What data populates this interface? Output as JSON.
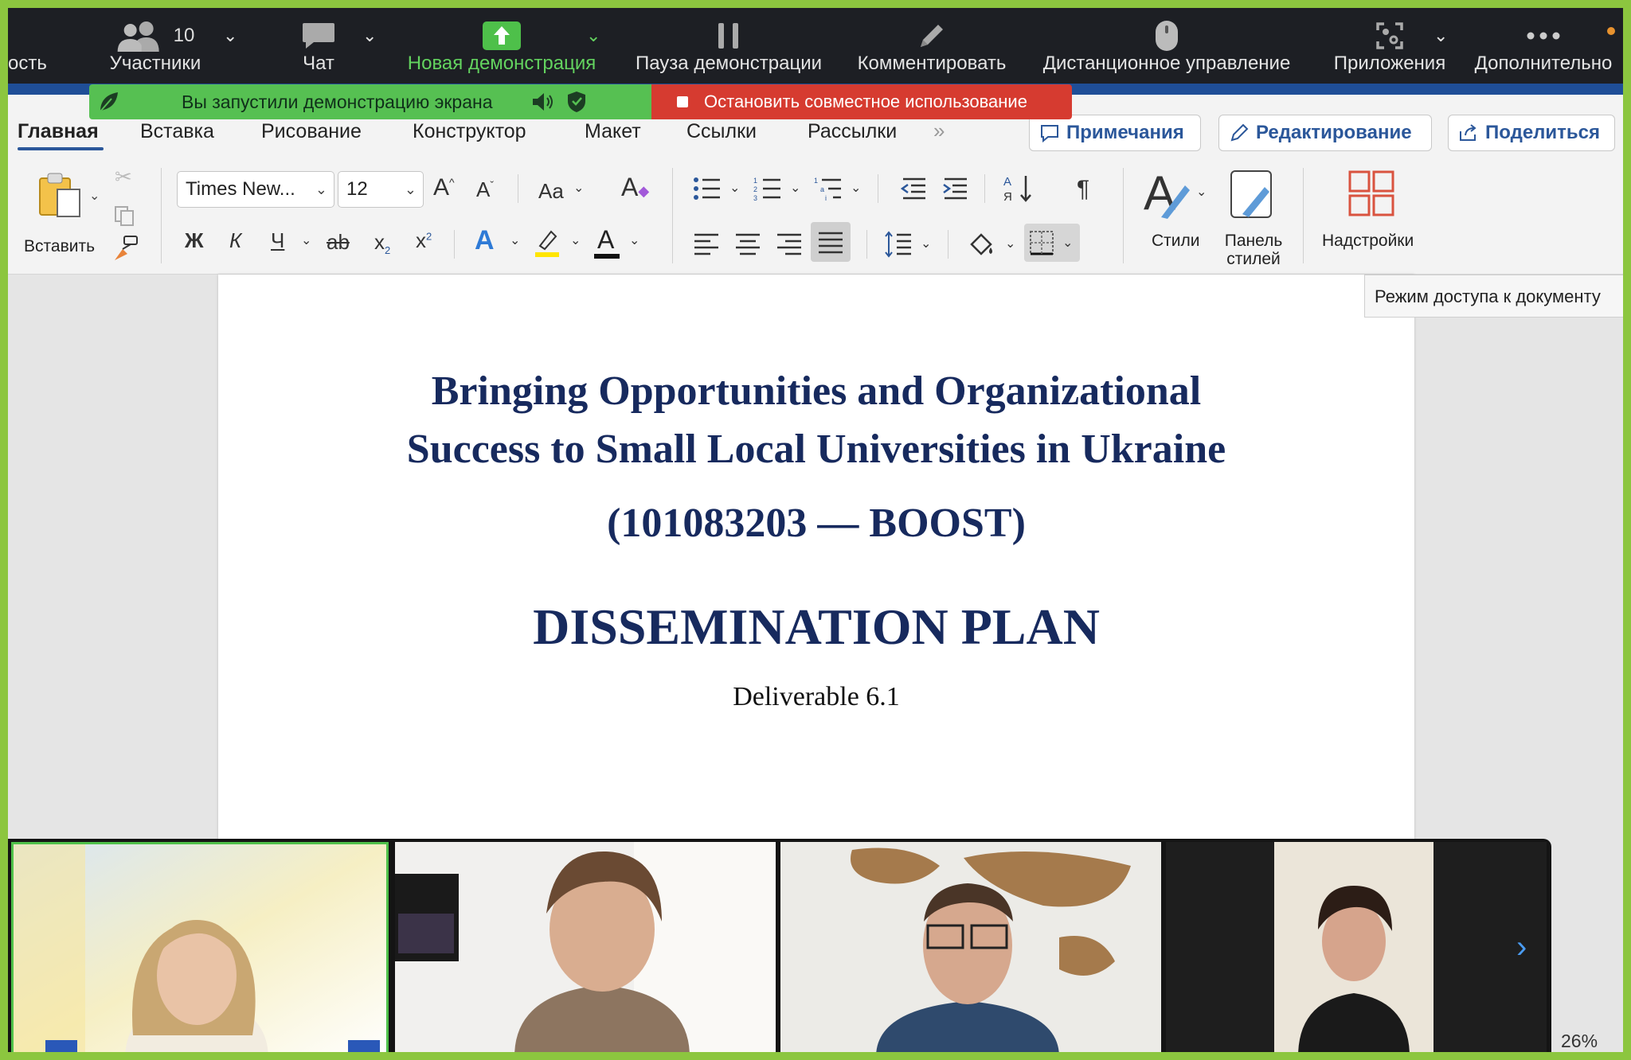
{
  "zoom_toolbar": {
    "partial_left_label": "ость",
    "participants": {
      "label": "Участники",
      "count": "10"
    },
    "chat": {
      "label": "Чат"
    },
    "new_share": {
      "label": "Новая демонстрация"
    },
    "pause_share": {
      "label": "Пауза демонстрации"
    },
    "annotate": {
      "label": "Комментировать"
    },
    "remote_control": {
      "label": "Дистанционное управление"
    },
    "apps": {
      "label": "Приложения"
    },
    "more": {
      "label": "Дополнительно"
    }
  },
  "share_notifications": {
    "status": "Вы запустили демонстрацию экрана",
    "stop_button": "Остановить совместное использование"
  },
  "ribbon": {
    "tabs": [
      "Главная",
      "Вставка",
      "Рисование",
      "Конструктор",
      "Макет",
      "Ссылки",
      "Рассылки"
    ],
    "active_tab": "Главная",
    "comments_button": "Примечания",
    "editing_button": "Редактирование",
    "share_button": "Поделиться",
    "paste_label": "Вставить",
    "font_name": "Times New...",
    "font_size": "12",
    "change_case_label": "Aa",
    "styles_label": "Стили",
    "styles_pane_label": "Панель стилей",
    "addins_label": "Надстройки",
    "format": {
      "bold": "Ж",
      "italic": "К",
      "underline": "Ч",
      "strike": "ab"
    }
  },
  "tooltip": "Режим доступа к документу",
  "document": {
    "title_line1": "Bringing Opportunities and Organizational",
    "title_line2": "Success to Small Local Universities in Ukraine",
    "project_code": "(101083203 — BOOST)",
    "heading": "DISSEMINATION PLAN",
    "deliverable": "Deliverable 6.1"
  },
  "status_bar": {
    "zoom": "26%"
  },
  "gallery": {
    "tile_count": 4,
    "active_speaker_index": 0
  },
  "colors": {
    "share_green": "#56c052",
    "stop_red": "#d63b30",
    "doc_title": "#172a5e",
    "accent_blue": "#2b579a",
    "frame_green": "#8cc63f"
  }
}
